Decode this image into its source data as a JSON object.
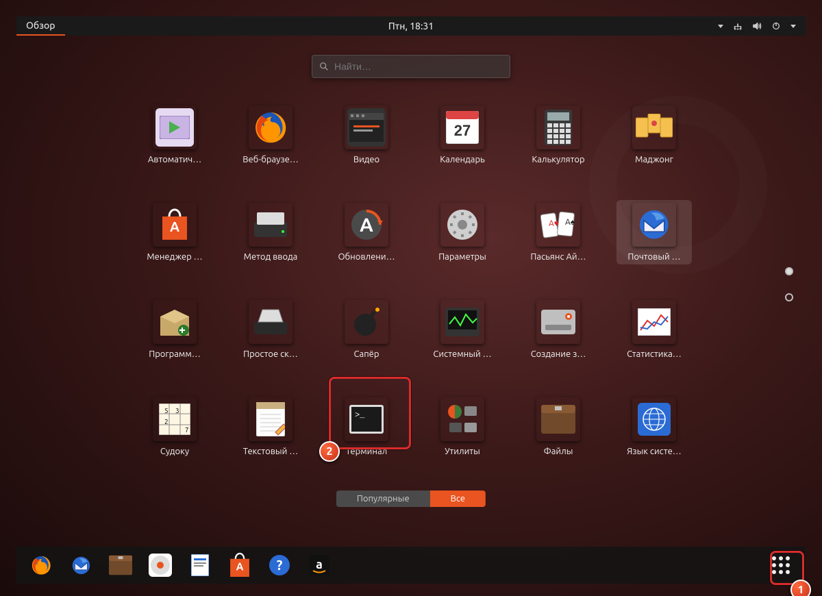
{
  "topbar": {
    "activities_label": "Обзор",
    "clock": "Птн, 18:31"
  },
  "search": {
    "placeholder": "Найти…"
  },
  "apps": [
    {
      "id": "auto",
      "label": "Автоматич…",
      "icon": "auto"
    },
    {
      "id": "firefox",
      "label": "Веб-браузе…",
      "icon": "firefox"
    },
    {
      "id": "video",
      "label": "Видео",
      "icon": "video"
    },
    {
      "id": "calendar",
      "label": "Календарь",
      "icon": "calendar",
      "badge_text": "27"
    },
    {
      "id": "calc",
      "label": "Калькулятор",
      "icon": "calc"
    },
    {
      "id": "mahjong",
      "label": "Маджонг",
      "icon": "mahjong"
    },
    {
      "id": "software",
      "label": "Менеджер …",
      "icon": "bag"
    },
    {
      "id": "input",
      "label": "Метод ввода",
      "icon": "scanner"
    },
    {
      "id": "updates",
      "label": "Обновлени…",
      "icon": "updater"
    },
    {
      "id": "settings",
      "label": "Параметры",
      "icon": "gear"
    },
    {
      "id": "solitaire",
      "label": "Пасьянс Ай…",
      "icon": "cards"
    },
    {
      "id": "mail",
      "label": "Почтовый …",
      "icon": "thunderbird",
      "selected": true
    },
    {
      "id": "packages",
      "label": "Программ…",
      "icon": "box"
    },
    {
      "id": "scan",
      "label": "Простое ск…",
      "icon": "scanner2"
    },
    {
      "id": "mines",
      "label": "Сапёр",
      "icon": "bomb"
    },
    {
      "id": "sysmon",
      "label": "Системный …",
      "icon": "monitor"
    },
    {
      "id": "backup",
      "label": "Создание з…",
      "icon": "drive"
    },
    {
      "id": "stats",
      "label": "Статистика…",
      "icon": "chart"
    },
    {
      "id": "sudoku",
      "label": "Судоку",
      "icon": "sudoku"
    },
    {
      "id": "gedit",
      "label": "Текстовый …",
      "icon": "notepad"
    },
    {
      "id": "terminal",
      "label": "Терминал",
      "icon": "terminal"
    },
    {
      "id": "utilities",
      "label": "Утилиты",
      "icon": "utilities"
    },
    {
      "id": "files",
      "label": "Файлы",
      "icon": "files"
    },
    {
      "id": "lang",
      "label": "Язык систе…",
      "icon": "globe"
    }
  ],
  "tabs": {
    "frequent": "Популярные",
    "all": "Все",
    "active": "all"
  },
  "dock": [
    {
      "id": "firefox",
      "icon": "firefox"
    },
    {
      "id": "thunderbird",
      "icon": "thunderbird"
    },
    {
      "id": "files",
      "icon": "files"
    },
    {
      "id": "rhythmbox",
      "icon": "music"
    },
    {
      "id": "writer",
      "icon": "writer"
    },
    {
      "id": "software",
      "icon": "bag"
    },
    {
      "id": "help",
      "icon": "help"
    },
    {
      "id": "amazon",
      "icon": "amazon"
    }
  ],
  "annotations": {
    "badge1": "1",
    "badge2": "2"
  },
  "calendar_day": "27",
  "colors": {
    "accent": "#e95420",
    "highlight": "#d92b2b"
  }
}
